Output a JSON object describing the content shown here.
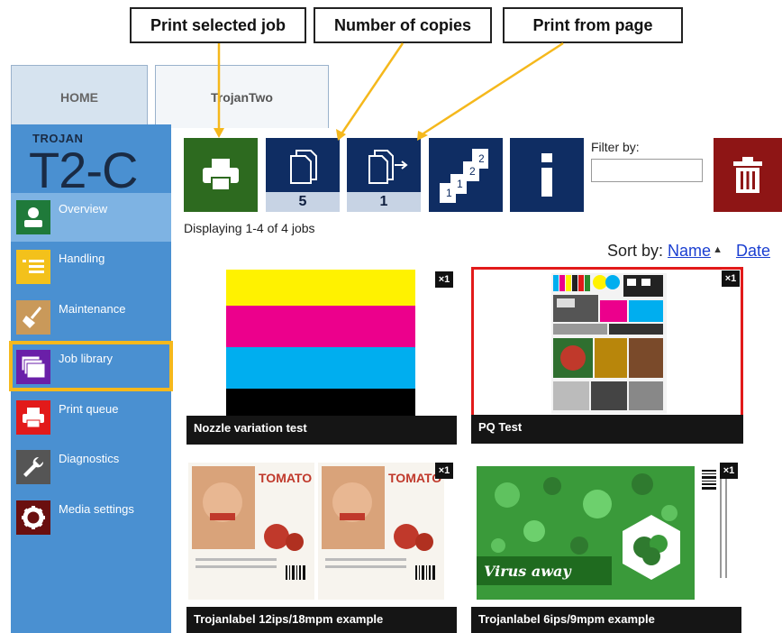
{
  "callouts": {
    "print_selected": "Print selected job",
    "number_copies": "Number of copies",
    "print_from_page": "Print from page"
  },
  "tabs": [
    {
      "label": "HOME"
    },
    {
      "label": "TrojanTwo"
    }
  ],
  "brand": {
    "small": "TROJAN",
    "big": "T2-C"
  },
  "sidebar": {
    "items": [
      {
        "label": "Overview",
        "icon": "person-icon",
        "color": "#1f7a3a"
      },
      {
        "label": "Handling",
        "icon": "handling-icon",
        "color": "#f3c11b"
      },
      {
        "label": "Maintenance",
        "icon": "broom-icon",
        "color": "#c9995a"
      },
      {
        "label": "Job library",
        "icon": "library-icon",
        "color": "#6a1fa8"
      },
      {
        "label": "Print queue",
        "icon": "printer-icon",
        "color": "#e21a1a"
      },
      {
        "label": "Diagnostics",
        "icon": "wrench-icon",
        "color": "#555555"
      },
      {
        "label": "Media settings",
        "icon": "gear-icon",
        "color": "#6a0f0f"
      }
    ]
  },
  "toolbar": {
    "copies_value": "5",
    "page_value": "1",
    "filter_label": "Filter by:",
    "filter_value": ""
  },
  "list": {
    "displaying": "Displaying 1-4 of 4 jobs",
    "sort_label": "Sort by:",
    "sort_name": "Name",
    "sort_date": "Date"
  },
  "jobs": [
    {
      "title": "Nozzle variation test",
      "copies": "×1"
    },
    {
      "title": "PQ Test",
      "copies": "×1"
    },
    {
      "title": "Trojanlabel 12ips/18mpm example",
      "copies": "×1"
    },
    {
      "title": "Trojanlabel 6ips/9mpm example",
      "copies": "×1"
    }
  ],
  "label_art": {
    "brand_text": "TOMATO",
    "virus_text": "Virus away"
  },
  "colors": {
    "accent_highlight": "#f5b81c",
    "sidebar_bg": "#4a90d1",
    "toolbar_navy": "#0f2d63",
    "print_green": "#2d6a1f",
    "delete_red": "#8e1515"
  }
}
